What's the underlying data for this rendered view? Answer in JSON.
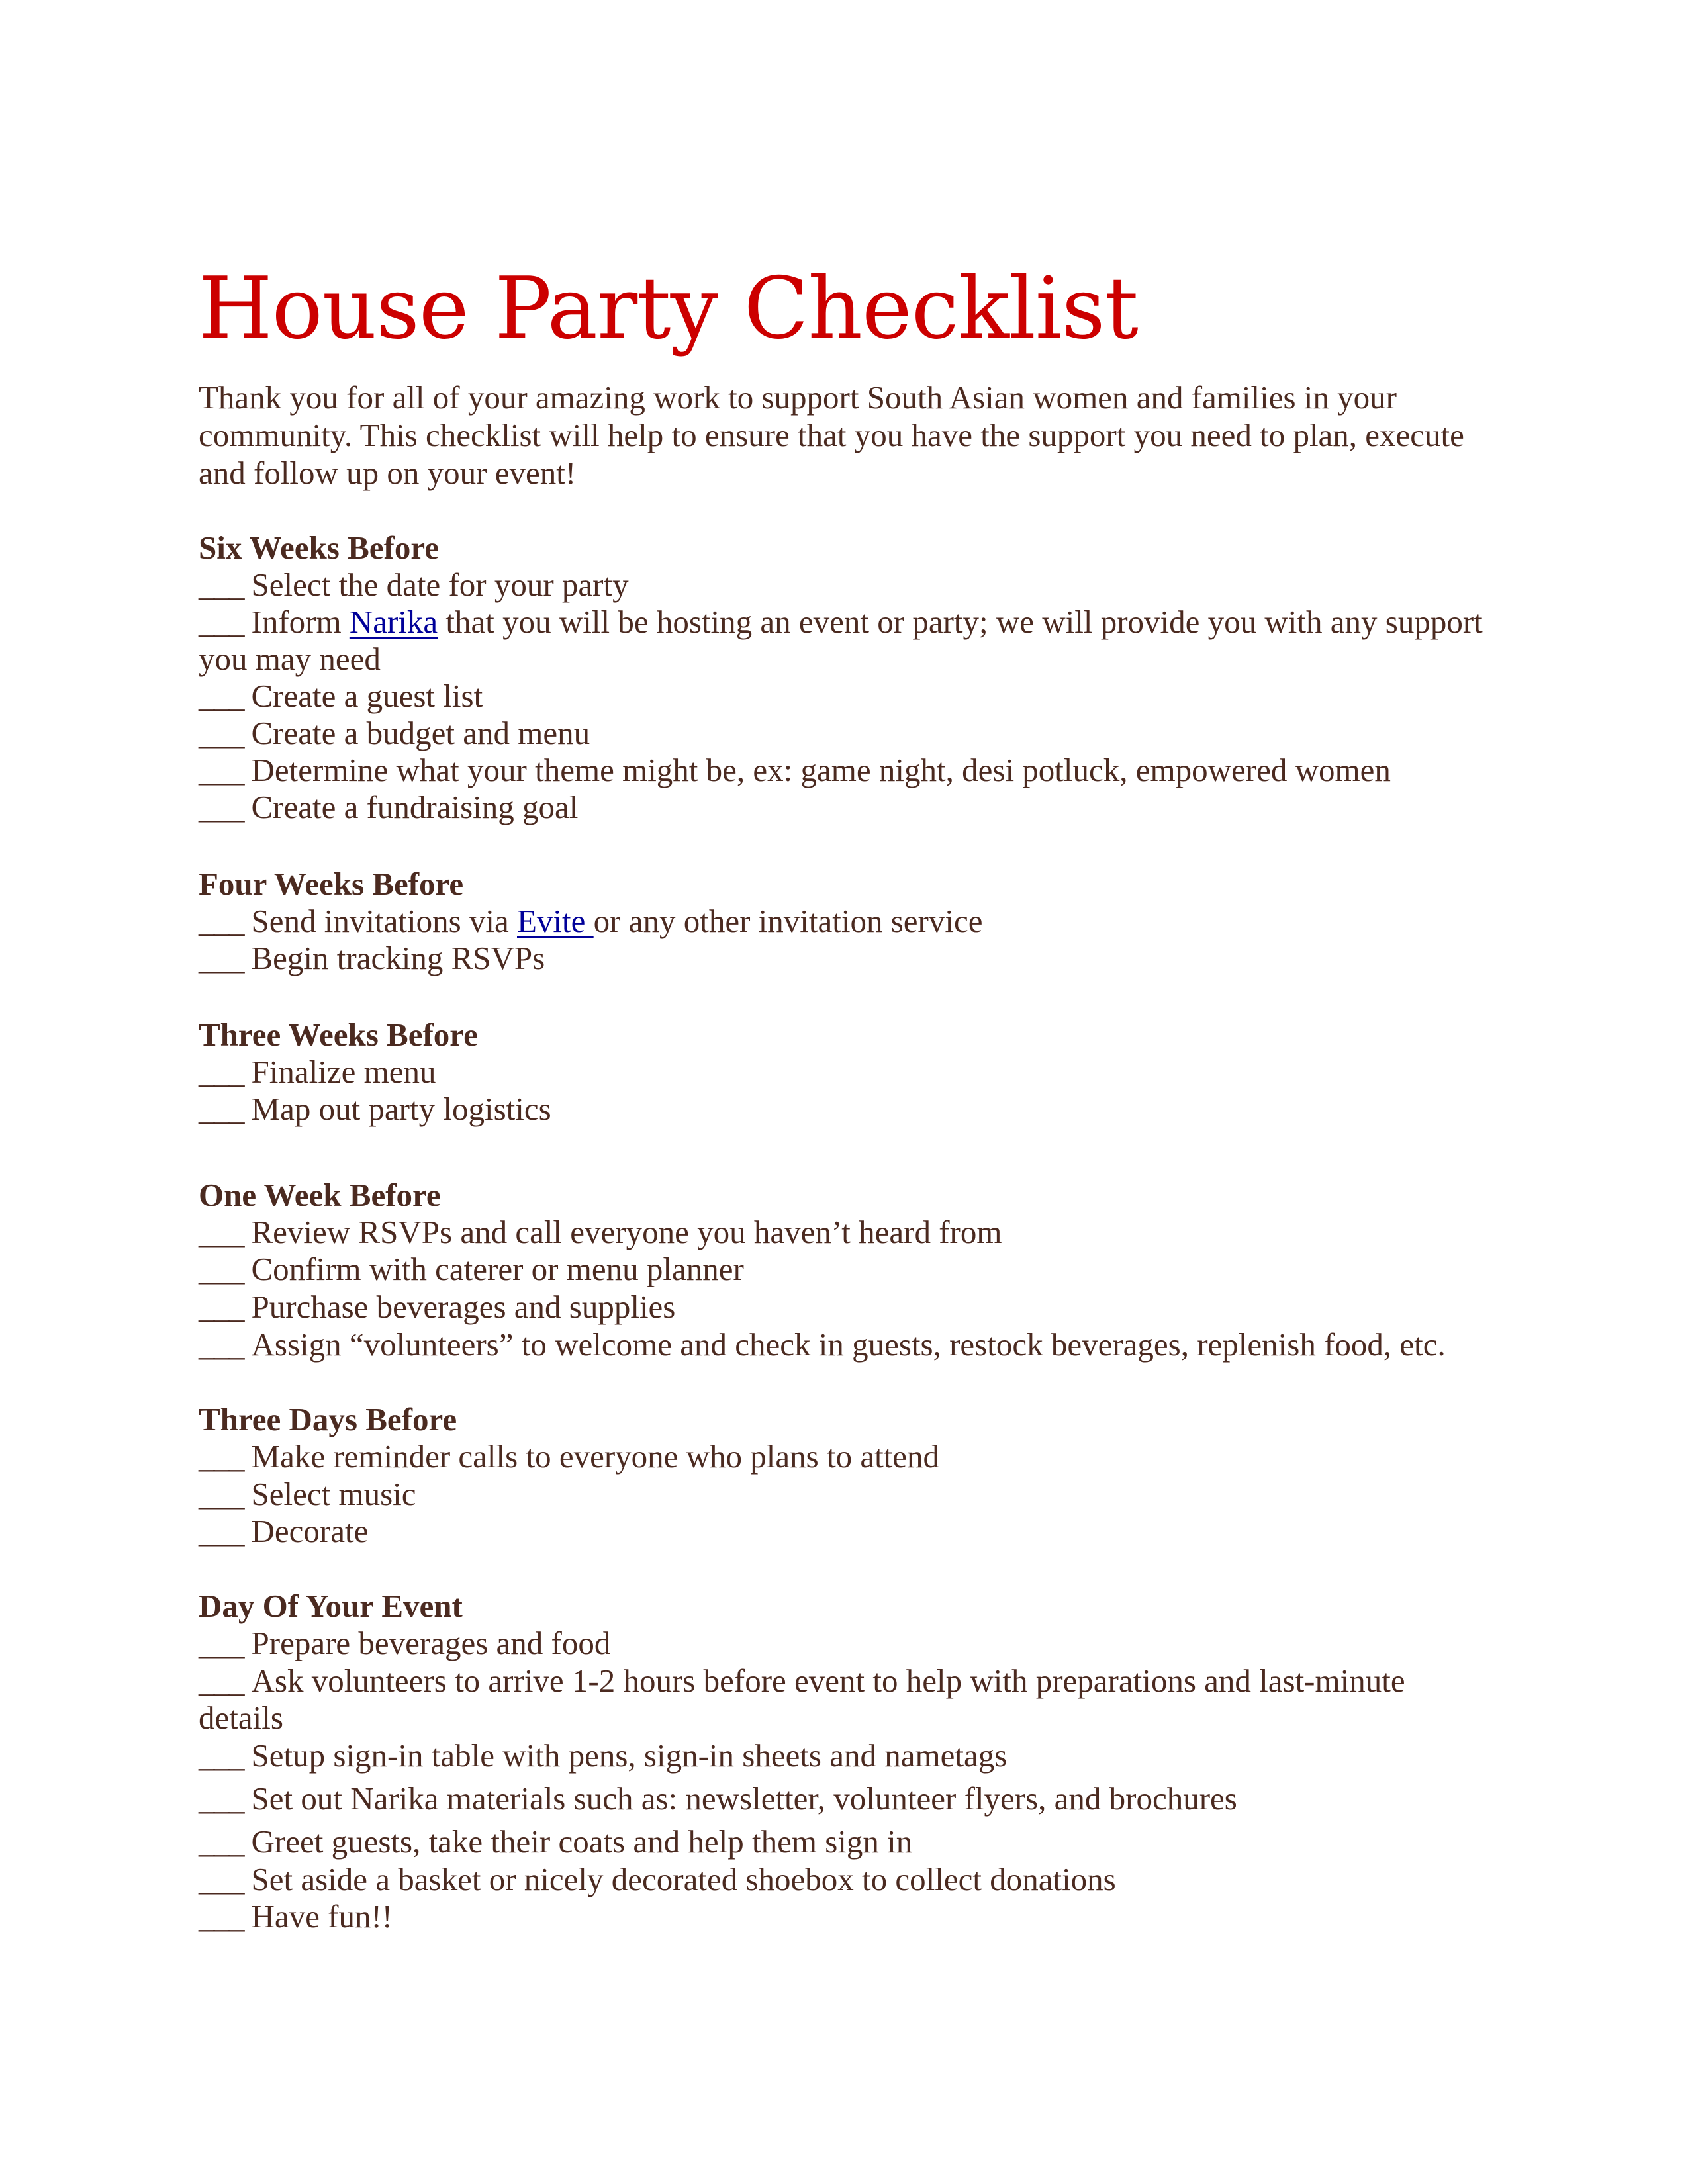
{
  "document": {
    "title": "House Party Checklist",
    "intro_lines": [
      "Thank you for all of your amazing work to support South Asian women and families in your",
      "community. This checklist will help to ensure that you have the support you need to plan, execute",
      "and follow up on your event!"
    ],
    "blank_marker": "___",
    "colors": {
      "title": "#cc0000",
      "body_text": "#4b2a20",
      "link": "#000099"
    }
  },
  "sections": [
    {
      "heading": "Six Weeks Before",
      "items": [
        {
          "text": "Select the date for your party"
        },
        {
          "before": "Inform ",
          "link": "Narika",
          "after": " that you will be hosting an event or party; we will provide you with any support",
          "continuation": "you may need"
        },
        {
          "text": "Create a guest list"
        },
        {
          "text": "Create a budget and menu"
        },
        {
          "text": "Determine what your theme might be, ex: game night, desi potluck, empowered women"
        },
        {
          "text": "Create a fundraising goal"
        }
      ]
    },
    {
      "heading": "Four Weeks Before",
      "items": [
        {
          "before": "Send invitations via ",
          "link": "Evite ",
          "after": "or any other invitation service"
        },
        {
          "text": "Begin tracking RSVPs"
        }
      ]
    },
    {
      "heading": "Three Weeks Before",
      "items": [
        {
          "text": "Finalize menu"
        },
        {
          "text": "Map out party logistics"
        }
      ]
    },
    {
      "heading": "One Week Before",
      "items": [
        {
          "text": "Review RSVPs and call everyone you haven’t heard from"
        },
        {
          "text": "Confirm with caterer or menu planner"
        },
        {
          "text": "Purchase beverages and supplies"
        },
        {
          "text": "Assign “volunteers” to welcome and check in guests, restock beverages, replenish food, etc."
        }
      ]
    },
    {
      "heading": "Three Days Before",
      "items": [
        {
          "text": "Make reminder calls to everyone who plans to attend"
        },
        {
          "text": "Select music"
        },
        {
          "text": "Decorate"
        }
      ]
    },
    {
      "heading": "Day Of Your Event",
      "items": [
        {
          "text": "Prepare beverages and food"
        },
        {
          "text": "Ask volunteers to arrive 1-2 hours before event to help with preparations and last-minute",
          "continuation": "details"
        },
        {
          "text": "Setup sign-in table with pens, sign-in sheets and nametags"
        },
        {
          "text": "Set out Narika materials such as: newsletter, volunteer flyers, and brochures"
        },
        {
          "text": "Greet guests, take their coats and help them sign in"
        },
        {
          "text": "Set aside a basket or nicely decorated shoebox to collect donations"
        },
        {
          "text": "Have fun!!"
        }
      ]
    }
  ]
}
